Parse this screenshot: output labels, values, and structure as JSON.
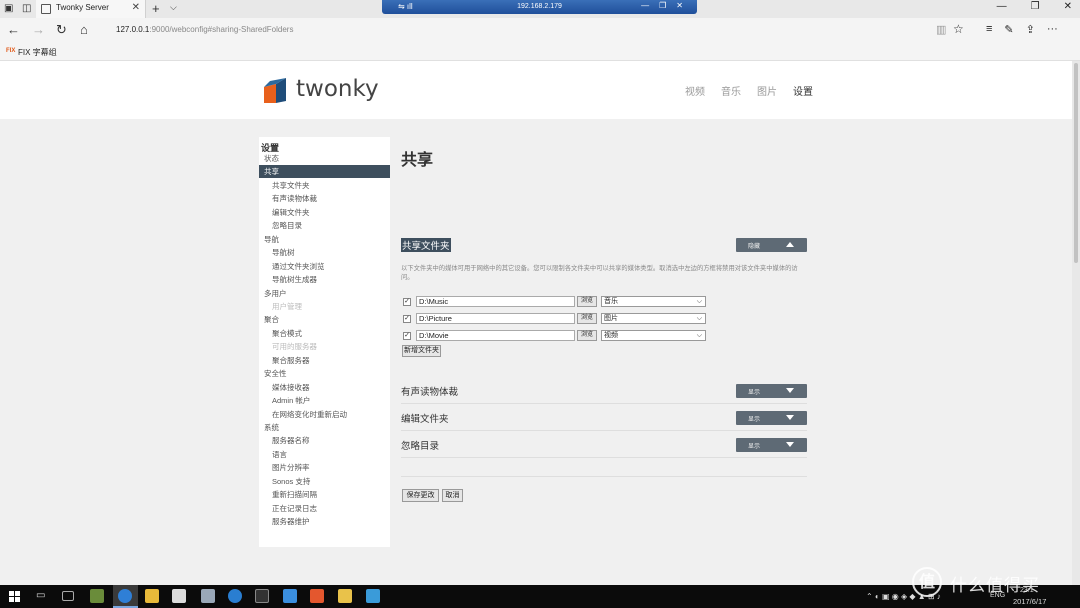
{
  "browser": {
    "tab_title": "Twonky Server",
    "url_host": "127.0.0.1",
    "url_rest": ":9000/webconfig#sharing-SharedFolders",
    "favorites": [
      {
        "label": "FIX 字幕组"
      }
    ],
    "rdp_host": "192.168.2.179",
    "new_tab_icon": "plus-icon",
    "accent": "#2a5aa8"
  },
  "header": {
    "logo_text": "twonky",
    "logo_colors": {
      "orange": "#e8601c",
      "blue": "#1f4d7a"
    },
    "nav": [
      {
        "label": "视频",
        "active": false
      },
      {
        "label": "音乐",
        "active": false
      },
      {
        "label": "图片",
        "active": false
      },
      {
        "label": "设置",
        "active": true
      }
    ]
  },
  "sidebar": {
    "title": "设置",
    "items": [
      {
        "label": "状态",
        "level": 0,
        "state": "normal"
      },
      {
        "label": "共享",
        "level": 0,
        "state": "active"
      },
      {
        "label": "共享文件夹",
        "level": 1,
        "state": "normal"
      },
      {
        "label": "有声读物体裁",
        "level": 1,
        "state": "normal"
      },
      {
        "label": "编辑文件夹",
        "level": 1,
        "state": "normal"
      },
      {
        "label": "忽略目录",
        "level": 1,
        "state": "normal"
      },
      {
        "label": "导航",
        "level": 0,
        "state": "normal"
      },
      {
        "label": "导航树",
        "level": 1,
        "state": "normal"
      },
      {
        "label": "通过文件夹浏览",
        "level": 1,
        "state": "normal"
      },
      {
        "label": "导航树生成器",
        "level": 1,
        "state": "normal"
      },
      {
        "label": "多用户",
        "level": 0,
        "state": "normal"
      },
      {
        "label": "用户管理",
        "level": 1,
        "state": "disabled"
      },
      {
        "label": "聚合",
        "level": 0,
        "state": "normal"
      },
      {
        "label": "聚合模式",
        "level": 1,
        "state": "normal"
      },
      {
        "label": "可用的服务器",
        "level": 1,
        "state": "disabled"
      },
      {
        "label": "聚合服务器",
        "level": 1,
        "state": "normal"
      },
      {
        "label": "安全性",
        "level": 0,
        "state": "normal"
      },
      {
        "label": "媒体接收器",
        "level": 1,
        "state": "normal"
      },
      {
        "label": "Admin 帐户",
        "level": 1,
        "state": "normal"
      },
      {
        "label": "在网络变化时重新启动",
        "level": 1,
        "state": "normal"
      },
      {
        "label": "系统",
        "level": 0,
        "state": "normal"
      },
      {
        "label": "服务器名称",
        "level": 1,
        "state": "normal"
      },
      {
        "label": "语言",
        "level": 1,
        "state": "normal"
      },
      {
        "label": "图片分辨率",
        "level": 1,
        "state": "normal"
      },
      {
        "label": "Sonos 支持",
        "level": 1,
        "state": "normal"
      },
      {
        "label": "重新扫描间隔",
        "level": 1,
        "state": "normal"
      },
      {
        "label": "正在记录日志",
        "level": 1,
        "state": "normal"
      },
      {
        "label": "服务器维护",
        "level": 1,
        "state": "normal"
      }
    ]
  },
  "main": {
    "heading": "共享",
    "shared_section": {
      "title": "共享文件夹",
      "toggle_label": "隐藏",
      "description": "以下文件夹中的媒体可用于网络中的其它设备。您可以限制各文件夹中可以共享的媒体类型。取消选中左边的方框将禁用对该文件夹中媒体的访问。",
      "browse_label": "浏览",
      "folders": [
        {
          "checked": true,
          "path": "D:\\Music",
          "type": "音乐"
        },
        {
          "checked": true,
          "path": "D:\\Picture",
          "type": "图片"
        },
        {
          "checked": true,
          "path": "D:\\Movie",
          "type": "视频"
        }
      ],
      "add_folder_label": "新增文件夹"
    },
    "collapsed_sections": [
      {
        "title": "有声读物体裁",
        "toggle_label": "显示"
      },
      {
        "title": "编辑文件夹",
        "toggle_label": "显示"
      },
      {
        "title": "忽略目录",
        "toggle_label": "显示"
      }
    ],
    "save_label": "保存更改",
    "cancel_label": "取消"
  },
  "taskbar": {
    "lang": "ENG",
    "time": "23:1",
    "date": "2017/6/17"
  },
  "watermark": {
    "symbol": "值",
    "text": "什么值得买"
  }
}
